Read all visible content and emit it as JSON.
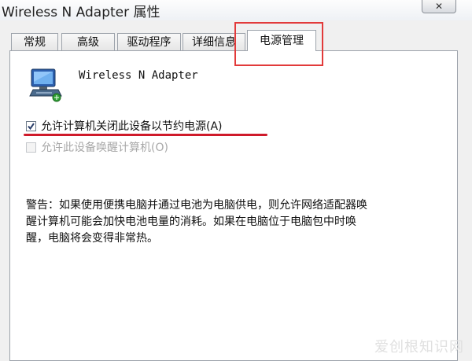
{
  "window": {
    "title": "Wireless N Adapter 属性",
    "close_glyph": "✕"
  },
  "tabs": [
    {
      "label": "常规"
    },
    {
      "label": "高级"
    },
    {
      "label": "驱动程序"
    },
    {
      "label": "详细信息"
    },
    {
      "label": "电源管理",
      "active": true
    }
  ],
  "device": {
    "name": "Wireless N Adapter",
    "icon": "network-adapter-icon"
  },
  "options": [
    {
      "label": "允许计算机关闭此设备以节约电源(A)",
      "checked": true,
      "enabled": true
    },
    {
      "label": "允许此设备唤醒计算机(O)",
      "checked": false,
      "enabled": false
    }
  ],
  "warning": {
    "line1": "警告：如果使用便携电脑并通过电池为电脑供电，则允许网络适配器唤",
    "line2": "醒计算机可能会加快电池电量的消耗。如果在电脑位于电脑包中时唤",
    "line3": "醒，电脑将会变得非常热。"
  },
  "watermark": "爱创根知识网",
  "colors": {
    "highlight": "#e23a3a",
    "underline": "#cf1a2a"
  }
}
